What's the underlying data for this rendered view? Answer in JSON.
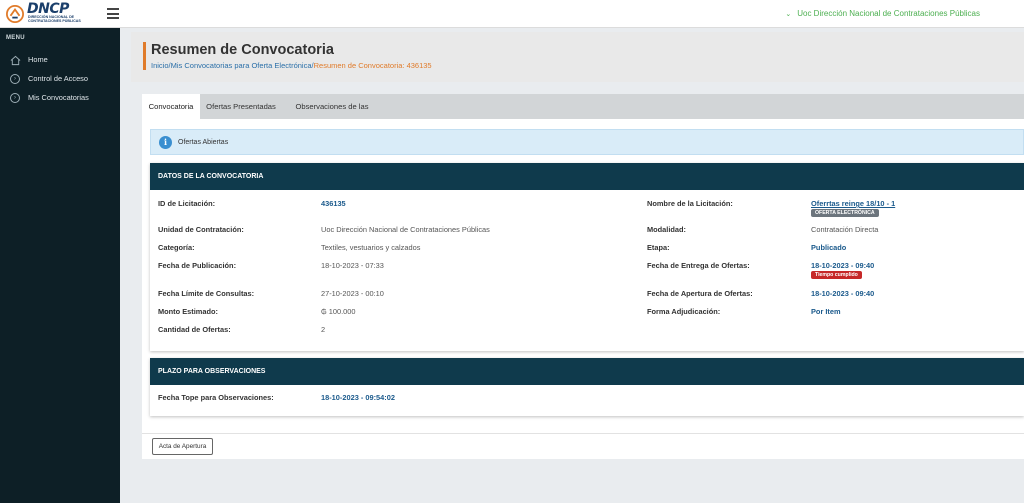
{
  "brand": {
    "logo_text": "DNCP",
    "logo_sub": "Dirección Nacional de Contrataciones Públicas",
    "accent": "#e07b2a",
    "primary": "#0f3a4c"
  },
  "topbar": {
    "organization": "Uoc Dirección Nacional de Contrataciones Públicas",
    "chevron_icon": "chevron-down-icon"
  },
  "sidebar": {
    "title": "MENU",
    "items": [
      {
        "label": "Home",
        "icon": "home-icon"
      },
      {
        "label": "Control de Acceso",
        "icon": "chevron-right-circle-icon"
      },
      {
        "label": "Mis Convocatorias",
        "icon": "chevron-right-circle-icon"
      }
    ]
  },
  "page": {
    "title": "Resumen de Convocatoria",
    "breadcrumb": {
      "inicio": "Inicio",
      "sep1": "/",
      "mis_convocatorias": "Mis Convocatorias para Oferta Electrónica",
      "sep2": "/",
      "current": "Resumen de Convocatoria: 436135"
    }
  },
  "tabs": [
    {
      "label": "Convocatoria",
      "active": true
    },
    {
      "label": "Ofertas Presentadas",
      "active": false
    },
    {
      "label": "Observaciones de las Ofertas",
      "active": false
    }
  ],
  "alert": {
    "text": "Ofertas Abiertas",
    "icon": "info-icon"
  },
  "datos": {
    "header": "DATOS DE LA CONVOCATORIA",
    "left": [
      {
        "label": "ID de Licitación:",
        "value": "436135"
      },
      {
        "label": "Unidad de Contratación:",
        "value": "Uoc Dirección Nacional de Contrataciones Públicas"
      },
      {
        "label": "Categoría:",
        "value": "Textiles, vestuarios y calzados"
      },
      {
        "label": "Fecha de Publicación:",
        "value": "18-10-2023 - 07:33"
      },
      {
        "label": "Fecha Límite de Consultas:",
        "value": "27-10-2023 - 00:10"
      },
      {
        "label": "Monto Estimado:",
        "value": "₲ 100.000"
      },
      {
        "label": "Cantidad de Ofertas:",
        "value": "2"
      }
    ],
    "right": [
      {
        "label": "Nombre de la Licitación:",
        "value": "Oferrtas reinge 18/10 - 1",
        "badge": "OFERTA ELECTRÓNICA"
      },
      {
        "label": "Modalidad:",
        "value": "Contratación Directa"
      },
      {
        "label": "Etapa:",
        "value": "Publicado"
      },
      {
        "label": "Fecha de Entrega de Ofertas:",
        "value": "18-10-2023 - 09:40",
        "badge": "Tiempo cumplido"
      },
      {
        "label": "Fecha de Apertura de Ofertas:",
        "value": "18-10-2023 - 09:40"
      },
      {
        "label": "Forma Adjudicación:",
        "value": "Por Item"
      }
    ]
  },
  "plazo": {
    "header": "PLAZO PARA OBSERVACIONES",
    "label": "Fecha Tope para Observaciones:",
    "value": "18-10-2023 - 09:54:02"
  },
  "actions": {
    "acta_button": "Acta de Apertura"
  }
}
